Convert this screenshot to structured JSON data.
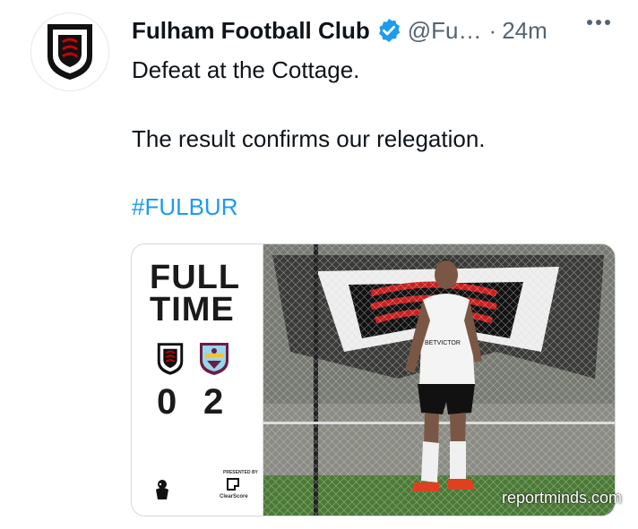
{
  "tweet": {
    "author_name": "Fulham Football Club",
    "handle": "@Fu…",
    "separator": "·",
    "time": "24m",
    "lines": [
      "Defeat at the Cottage.",
      "The result confirms our relegation."
    ],
    "hashtag": "#FULBUR"
  },
  "graphic": {
    "headline_line1": "FULL",
    "headline_line2": "TIME",
    "home_score": "0",
    "away_score": "2",
    "sponsor_caption": "PRESENTED BY",
    "sponsor_name": "ClearScore",
    "shirt_sponsor": "BETVICTOR"
  },
  "watermark": "reportminds.com",
  "icons": {
    "verified": "verified-badge-icon",
    "more": "more-options-icon",
    "home_crest": "fulham-crest",
    "away_crest": "burnley-crest",
    "league_logo": "premier-league-lion-icon",
    "sponsor_logo": "clearscore-logo-icon"
  },
  "colors": {
    "text": "#0f1419",
    "secondary": "#536471",
    "link": "#1d9bf0",
    "verified": "#1d9bf0",
    "fulham_red": "#cc0000",
    "burnley_claret": "#6c1d45",
    "burnley_blue": "#99d6ea"
  }
}
